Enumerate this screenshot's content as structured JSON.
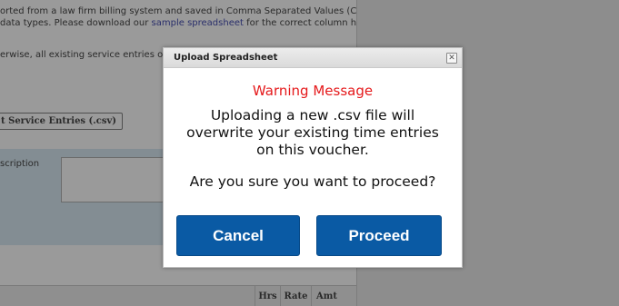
{
  "background": {
    "intro_line_1": "orted from a law firm billing system and saved in Comma Separated Values (CSV)",
    "intro_line_2_before": " data types. Please download our ",
    "intro_link": "sample spreadsheet",
    "intro_line_2_after": " for the correct column headings",
    "overwrite_note": "erwise, all existing service entries on th",
    "upload_button": "t Service Entries (.csv)",
    "description_label": "scription",
    "table_headers": [
      "Hrs",
      "Rate",
      "Amt"
    ]
  },
  "dialog": {
    "title": "Upload Spreadsheet",
    "close_glyph": "✕",
    "warning_heading": "Warning Message",
    "message_lines": [
      "Uploading a new .csv file will",
      "overwrite your existing time entries",
      "on this voucher."
    ],
    "question": "Are you sure you want to proceed?",
    "cancel_label": "Cancel",
    "proceed_label": "Proceed"
  },
  "colors": {
    "warning_text": "#e5191b",
    "button_bg": "#0a5aa4",
    "overlay": "#8d8d8d"
  }
}
